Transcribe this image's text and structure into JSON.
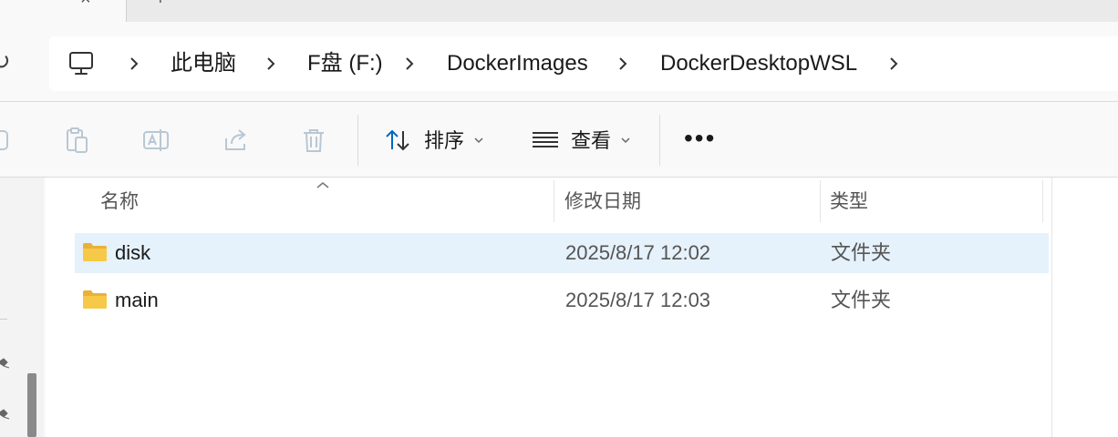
{
  "tabs": {
    "close_glyph": "×",
    "new_tab_glyph": "+"
  },
  "address": {
    "refresh_glyph": "↻",
    "breadcrumbs": [
      "此电脑",
      "F盘 (F:)",
      "DockerImages",
      "DockerDesktopWSL"
    ]
  },
  "toolbar": {
    "sort_label": "排序",
    "view_label": "查看",
    "more_label": "•••"
  },
  "columns": {
    "name": "名称",
    "date": "修改日期",
    "type": "类型"
  },
  "files": [
    {
      "name": "disk",
      "date": "2025/8/17 12:02",
      "type": "文件夹",
      "selected": true
    },
    {
      "name": "main",
      "date": "2025/8/17 12:03",
      "type": "文件夹",
      "selected": false
    }
  ],
  "colors": {
    "selection": "#e5f1fb",
    "folder_yellow": "#f7c948",
    "accent_blue": "#0067c0"
  }
}
